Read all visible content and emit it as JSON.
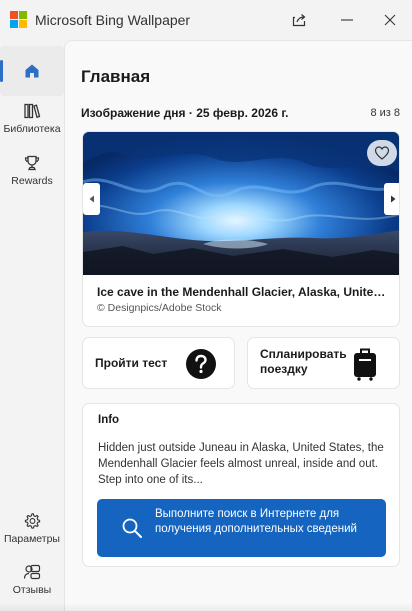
{
  "window": {
    "title": "Microsoft Bing Wallpaper",
    "logo_colors": [
      "#f25022",
      "#7fba00",
      "#00a4ef",
      "#ffb900"
    ]
  },
  "titlebar_buttons": {
    "share": "share-icon",
    "minimize": "minimize-icon",
    "close": "close-icon"
  },
  "sidebar": {
    "items": [
      {
        "id": "home",
        "label": "",
        "icon": "home-icon",
        "active": true
      },
      {
        "id": "library",
        "label": "Библиотека",
        "icon": "library-icon"
      },
      {
        "id": "rewards",
        "label": "Rewards",
        "icon": "trophy-icon"
      },
      {
        "id": "settings",
        "label": "Параметры",
        "icon": "gear-icon"
      },
      {
        "id": "feedback",
        "label": "Отзывы",
        "icon": "feedback-icon"
      }
    ]
  },
  "main": {
    "title": "Главная",
    "section_title": "Изображение дня · 25 февр. 2026 г.",
    "counter": "8 из 8",
    "image": {
      "title": "Ice cave in the Mendenhall Glacier, Alaska, United States",
      "credit": "© Designpics/Adobe Stock"
    },
    "actions": {
      "quiz_label": "Пройти тест",
      "trip_label": "Спланировать поездку"
    },
    "info": {
      "heading": "Info",
      "text": "Hidden just outside Juneau in Alaska, United States, the Mendenhall Glacier feels almost unreal, inside and out. Step into one of its...",
      "search_button": "Выполните поиск в Интернете для получения дополнительных сведений"
    }
  },
  "colors": {
    "accent": "#2b6fc7",
    "search_button": "#1565c0"
  }
}
